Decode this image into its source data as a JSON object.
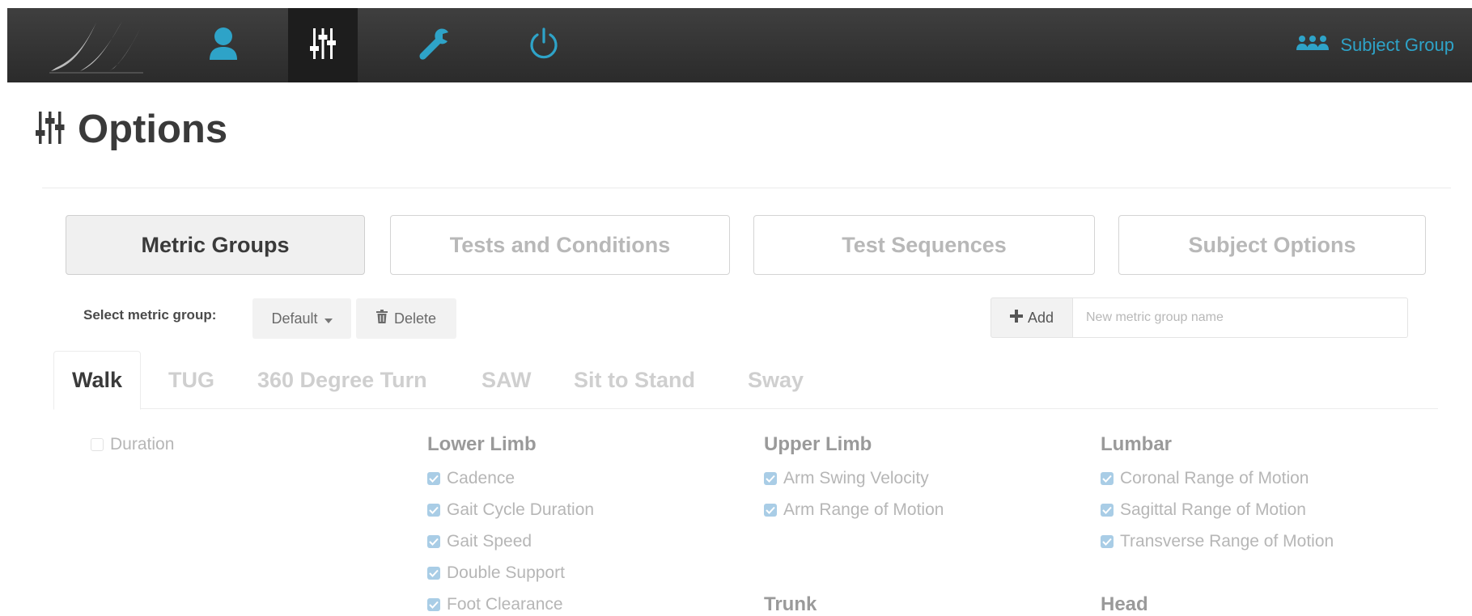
{
  "navbar": {
    "logo": "app-logo",
    "nav_items": [
      "user-icon",
      "sliders-icon",
      "wrench-icon",
      "power-icon"
    ],
    "subject_group_label": "Subject Group",
    "accent": "#2ea3c8"
  },
  "page": {
    "title": "Options"
  },
  "big_tabs": [
    {
      "label": "Metric Groups",
      "active": true
    },
    {
      "label": "Tests and Conditions",
      "active": false
    },
    {
      "label": "Test Sequences",
      "active": false
    },
    {
      "label": "Subject Options",
      "active": false
    }
  ],
  "metric_group": {
    "select_label": "Select metric group:",
    "selected": "Default",
    "delete_label": "Delete",
    "add_label": "Add",
    "name_placeholder": "New metric group name"
  },
  "test_tabs": [
    {
      "label": "Walk",
      "active": true
    },
    {
      "label": "TUG",
      "active": false
    },
    {
      "label": "360 Degree Turn",
      "active": false
    },
    {
      "label": "SAW",
      "active": false
    },
    {
      "label": "Sit to Stand",
      "active": false
    },
    {
      "label": "Sway",
      "active": false
    }
  ],
  "metrics": {
    "duration": {
      "label": "Duration",
      "checked": false
    },
    "lower_limb": {
      "title": "Lower Limb",
      "items": [
        {
          "label": "Cadence",
          "checked": true
        },
        {
          "label": "Gait Cycle Duration",
          "checked": true
        },
        {
          "label": "Gait Speed",
          "checked": true
        },
        {
          "label": "Double Support",
          "checked": true
        },
        {
          "label": "Foot Clearance",
          "checked": true
        }
      ]
    },
    "upper_limb": {
      "title": "Upper Limb",
      "items": [
        {
          "label": "Arm Swing Velocity",
          "checked": true
        },
        {
          "label": "Arm Range of Motion",
          "checked": true
        }
      ]
    },
    "trunk": {
      "title": "Trunk"
    },
    "lumbar": {
      "title": "Lumbar",
      "items": [
        {
          "label": "Coronal Range of Motion",
          "checked": true
        },
        {
          "label": "Sagittal Range of Motion",
          "checked": true
        },
        {
          "label": "Transverse Range of Motion",
          "checked": true
        }
      ]
    },
    "head": {
      "title": "Head"
    }
  }
}
